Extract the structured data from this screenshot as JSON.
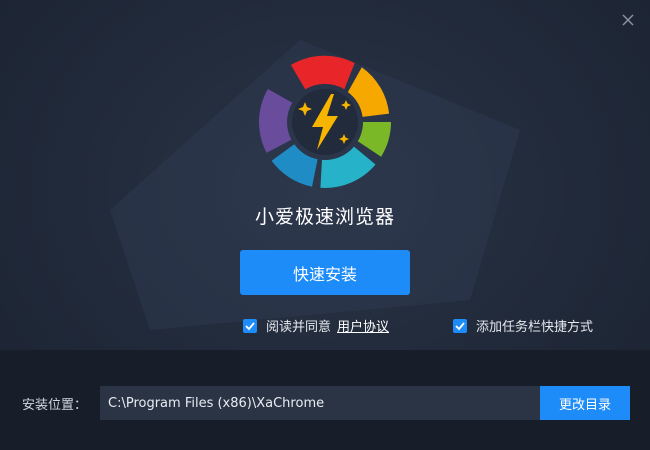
{
  "app": {
    "title": "小爱极速浏览器"
  },
  "install": {
    "label": "快速安装"
  },
  "options": {
    "agree_text": "阅读并同意",
    "agree_link": "用户协议",
    "agree_checked": true,
    "shortcut_text": "添加任务栏快捷方式",
    "shortcut_checked": true
  },
  "location": {
    "label": "安装位置：",
    "path": "C:\\Program Files (x86)\\XaChrome",
    "change_label": "更改目录"
  },
  "icons": {
    "close": "close-icon",
    "logo": "app-logo-icon",
    "check": "check-icon"
  },
  "colors": {
    "accent": "#1d8cf8",
    "background": "#212a3a",
    "footer": "#171e2a",
    "logo_segments": [
      "#e8262a",
      "#f7a800",
      "#7ab828",
      "#26b2c8",
      "#1f8cc6",
      "#6a4c9c"
    ]
  }
}
